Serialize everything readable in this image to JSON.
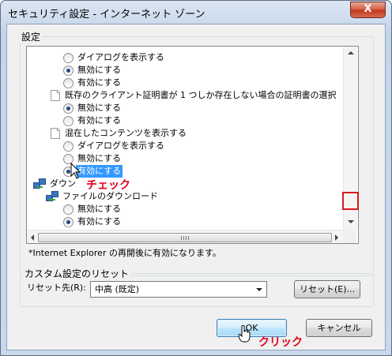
{
  "window": {
    "title": "セキュリティ設定 - インターネット ゾーン",
    "close_label": "X"
  },
  "settings": {
    "group_label": "設定",
    "rows": [
      {
        "kind": "radio",
        "label": "ダイアログを表示する",
        "checked": false
      },
      {
        "kind": "radio",
        "label": "無効にする",
        "checked": true
      },
      {
        "kind": "radio",
        "label": "有効にする",
        "checked": false
      },
      {
        "kind": "category",
        "label": "既存のクライアント証明書が 1 つしか存在しない場合の証明書の選択"
      },
      {
        "kind": "radio",
        "label": "無効にする",
        "checked": true
      },
      {
        "kind": "radio",
        "label": "有効にする",
        "checked": false
      },
      {
        "kind": "category",
        "label": "混在したコンテンツを表示する"
      },
      {
        "kind": "radio",
        "label": "ダイアログを表示する",
        "checked": false
      },
      {
        "kind": "radio",
        "label": "無効にする",
        "checked": false
      },
      {
        "kind": "radio",
        "label": "有効にする",
        "checked": true,
        "selected": true
      },
      {
        "kind": "section",
        "label": "ダウン"
      },
      {
        "kind": "subsection",
        "label": "ファイルのダウンロード"
      },
      {
        "kind": "radio",
        "label": "無効にする",
        "checked": false
      },
      {
        "kind": "radio",
        "label": "有効にする",
        "checked": true
      }
    ],
    "note": "*Internet Explorer の再開後に有効になります。"
  },
  "reset": {
    "group_label": "カスタム設定のリセット",
    "reset_to_label": "リセット先(R):",
    "selected_level": "中高 (既定)",
    "reset_button": "リセット(E)..."
  },
  "buttons": {
    "ok": "OK",
    "cancel": "キャンセル"
  },
  "annotations": {
    "check": "チェック",
    "click": "クリック"
  },
  "colors": {
    "annotation": "#e0001a",
    "selection": "#3399ff"
  }
}
